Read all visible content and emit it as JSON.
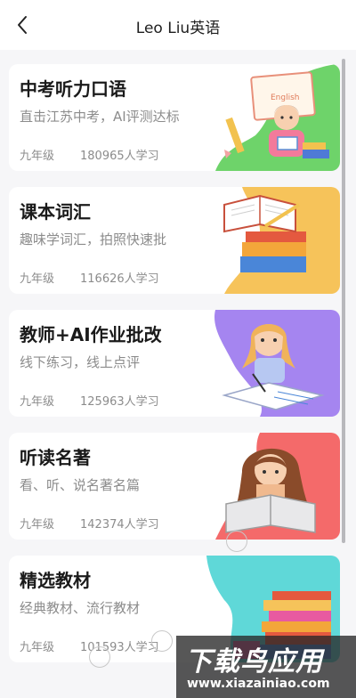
{
  "header": {
    "title": "Leo Liu英语",
    "back_icon": "chevron-left-icon"
  },
  "courses": [
    {
      "name": "中考听力口语",
      "desc": "直击江苏中考，AI评测达标",
      "grade": "九年级",
      "learners": "180965人学习",
      "art_badge": "English"
    },
    {
      "name": "课本词汇",
      "desc": "趣味学词汇，拍照快速批",
      "grade": "九年级",
      "learners": "116626人学习"
    },
    {
      "name": "教师+AI作业批改",
      "desc": "线下练习，线上点评",
      "grade": "九年级",
      "learners": "125963人学习"
    },
    {
      "name": "听读名著",
      "desc": "看、听、说名著名篇",
      "grade": "九年级",
      "learners": "142374人学习"
    },
    {
      "name": "精选教材",
      "desc": "经典教材、流行教材",
      "grade": "九年级",
      "learners": "101593人学习"
    }
  ],
  "watermark": {
    "title": "下载鸟应用",
    "url": "www.xiazainiao.com"
  },
  "colors": {
    "card1_bg": "#6ed36a",
    "card2_bg": "#f6c35a",
    "card3_bg": "#a585f0",
    "card4_bg": "#f46a6a",
    "card5_bg": "#5fd8d8"
  }
}
